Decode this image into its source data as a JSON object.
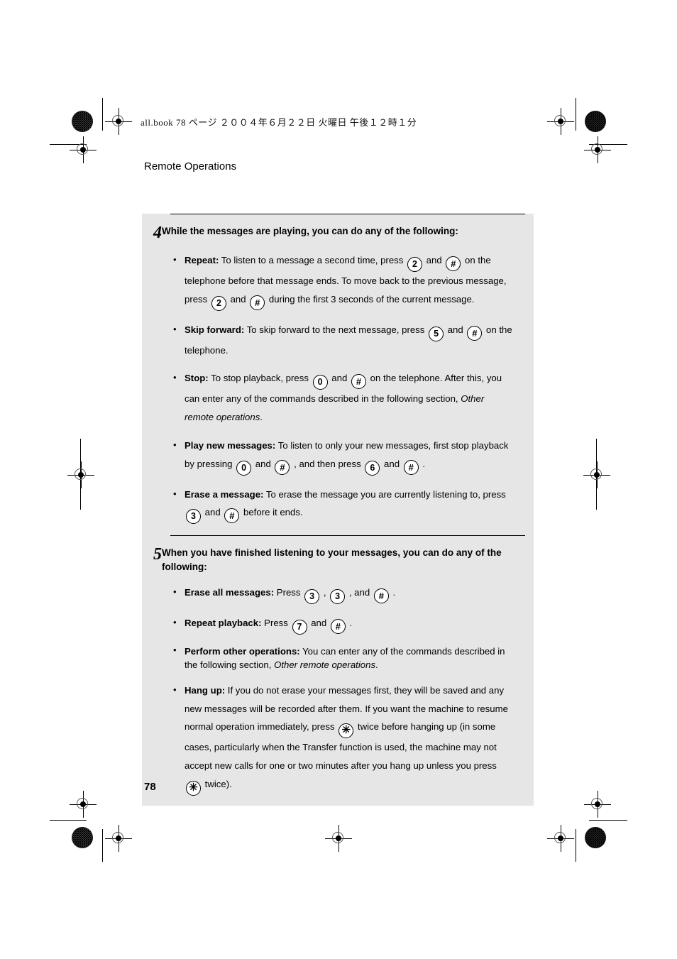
{
  "document": {
    "file_header": "all.book  78 ページ  ２００４年６月２２日  火曜日  午後１２時１分",
    "running_head": "Remote Operations",
    "page_number": "78",
    "panel_bg": "#e6e6e6"
  },
  "steps": [
    {
      "number": "4",
      "title": "While the messages are playing, you can do any of the following:",
      "bullets": [
        {
          "label": "Repeat:",
          "segments": [
            {
              "type": "text",
              "value": " To listen to a message a second time, press "
            },
            {
              "type": "key",
              "value": "2"
            },
            {
              "type": "text",
              "value": " and "
            },
            {
              "type": "key",
              "value": "#"
            },
            {
              "type": "text",
              "value": " on the telephone before that message ends. To move back to the previous message, press "
            },
            {
              "type": "key",
              "value": "2"
            },
            {
              "type": "text",
              "value": " and "
            },
            {
              "type": "key",
              "value": "#"
            },
            {
              "type": "text",
              "value": " during the first 3 seconds of the current message."
            }
          ]
        },
        {
          "label": "Skip forward:",
          "segments": [
            {
              "type": "text",
              "value": " To skip forward to the next message, press "
            },
            {
              "type": "key",
              "value": "5"
            },
            {
              "type": "text",
              "value": " and "
            },
            {
              "type": "key",
              "value": "#"
            },
            {
              "type": "text",
              "value": " on the telephone."
            }
          ]
        },
        {
          "label": "Stop:",
          "segments": [
            {
              "type": "text",
              "value": " To stop playback, press "
            },
            {
              "type": "key",
              "value": "0"
            },
            {
              "type": "text",
              "value": " and "
            },
            {
              "type": "key",
              "value": "#"
            },
            {
              "type": "text",
              "value": " on the telephone. After this, you can enter any of the commands described in the following section, "
            },
            {
              "type": "italic",
              "value": "Other remote operations"
            },
            {
              "type": "text",
              "value": "."
            }
          ]
        },
        {
          "label": "Play new messages:",
          "segments": [
            {
              "type": "text",
              "value": " To listen to only your new messages, first stop playback by pressing "
            },
            {
              "type": "key",
              "value": "0"
            },
            {
              "type": "text",
              "value": " and "
            },
            {
              "type": "key",
              "value": "#"
            },
            {
              "type": "text",
              "value": " , and then press "
            },
            {
              "type": "key",
              "value": "6"
            },
            {
              "type": "text",
              "value": " and "
            },
            {
              "type": "key",
              "value": "#"
            },
            {
              "type": "text",
              "value": " ."
            }
          ]
        },
        {
          "label": "Erase a message:",
          "segments": [
            {
              "type": "text",
              "value": " To erase the message you are currently listening to, press "
            },
            {
              "type": "key",
              "value": "3"
            },
            {
              "type": "text",
              "value": " and "
            },
            {
              "type": "key",
              "value": "#"
            },
            {
              "type": "text",
              "value": " before it ends."
            }
          ]
        }
      ]
    },
    {
      "number": "5",
      "title": "When you have finished listening to your messages, you can do any of the following:",
      "bullets": [
        {
          "label": "Erase all messages:",
          "segments": [
            {
              "type": "text",
              "value": " Press "
            },
            {
              "type": "key",
              "value": "3"
            },
            {
              "type": "text",
              "value": " , "
            },
            {
              "type": "key",
              "value": "3"
            },
            {
              "type": "text",
              "value": " , and "
            },
            {
              "type": "key",
              "value": "#"
            },
            {
              "type": "text",
              "value": " ."
            }
          ]
        },
        {
          "label": "Repeat playback:",
          "segments": [
            {
              "type": "text",
              "value": " Press "
            },
            {
              "type": "key",
              "value": "7"
            },
            {
              "type": "text",
              "value": " and "
            },
            {
              "type": "key",
              "value": "#"
            },
            {
              "type": "text",
              "value": " ."
            }
          ]
        },
        {
          "label": "Perform other operations:",
          "tight": true,
          "segments": [
            {
              "type": "text",
              "value": " You can enter any of the commands described in the following section, "
            },
            {
              "type": "italic",
              "value": "Other remote operations"
            },
            {
              "type": "text",
              "value": "."
            }
          ]
        },
        {
          "label": "Hang up:",
          "segments": [
            {
              "type": "text",
              "value": " If you do not erase your messages first, they will be saved and any new messages will be recorded after them. If you want the machine to resume normal operation immediately, press "
            },
            {
              "type": "key",
              "value": "*"
            },
            {
              "type": "text",
              "value": " twice before hanging up (in some cases, particularly when the Transfer function is used, the machine may not accept new calls for one or two minutes after you hang up unless you press "
            },
            {
              "type": "key",
              "value": "*"
            },
            {
              "type": "text",
              "value": " twice)."
            }
          ]
        }
      ]
    }
  ]
}
